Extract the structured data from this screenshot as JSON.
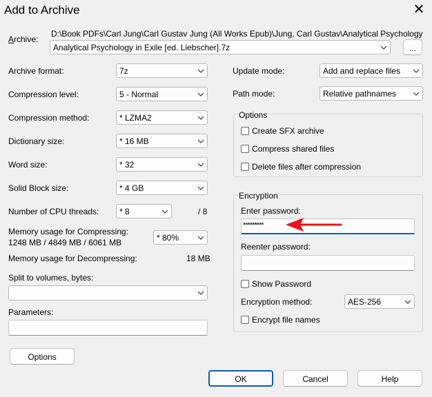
{
  "window": {
    "title": "Add to Archive",
    "close_glyph": "✕"
  },
  "archive": {
    "label": "Archive:",
    "path": "D:\\Book PDFs\\Carl Jung\\Carl Gustav Jung (All Works Epub)\\Jung, Carl Gustav\\Analytical Psychology in Exile [ed.",
    "filename": "Analytical Psychology in Exile [ed. Liebscher].7z",
    "browse_label": "..."
  },
  "left": {
    "archive_format": {
      "label": "Archive format:",
      "value": "7z"
    },
    "compression_level": {
      "label": "Compression level:",
      "value": "5 - Normal"
    },
    "compression_method": {
      "label": "Compression method:",
      "value": "*  LZMA2"
    },
    "dictionary_size": {
      "label": "Dictionary size:",
      "value": "*  16 MB"
    },
    "word_size": {
      "label": "Word size:",
      "value": "*  32"
    },
    "solid_block_size": {
      "label": "Solid Block size:",
      "value": "*  4 GB"
    },
    "cpu_threads": {
      "label": "Number of CPU threads:",
      "value": "*  8",
      "max": "/ 8"
    },
    "mem_compress": {
      "label": "Memory usage for Compressing:",
      "detail": "1248 MB / 4849 MB / 6061 MB",
      "value": "* 80%"
    },
    "mem_decompress": {
      "label": "Memory usage for Decompressing:",
      "value": "18 MB"
    },
    "split": {
      "label": "Split to volumes, bytes:",
      "value": ""
    },
    "parameters": {
      "label": "Parameters:",
      "value": ""
    },
    "options_button": "Options"
  },
  "right": {
    "update_mode": {
      "label": "Update mode:",
      "value": "Add and replace files"
    },
    "path_mode": {
      "label": "Path mode:",
      "value": "Relative pathnames"
    },
    "options_group": {
      "title": "Options",
      "create_sfx": "Create SFX archive",
      "compress_shared": "Compress shared files",
      "delete_after": "Delete files after compression"
    },
    "encryption": {
      "title": "Encryption",
      "enter_password_label": "Enter password:",
      "password_value": "*********",
      "reenter_label": "Reenter password:",
      "show_password": "Show Password",
      "method_label": "Encryption method:",
      "method_value": "AES-256",
      "encrypt_names": "Encrypt file names"
    }
  },
  "buttons": {
    "ok": "OK",
    "cancel": "Cancel",
    "help": "Help"
  },
  "colors": {
    "arrow": "#e8141c",
    "focus": "#0a5bb8"
  },
  "icons": {
    "dropdown": "chevron-down-icon",
    "close": "close-icon",
    "annotation": "red-arrow-annotation"
  }
}
